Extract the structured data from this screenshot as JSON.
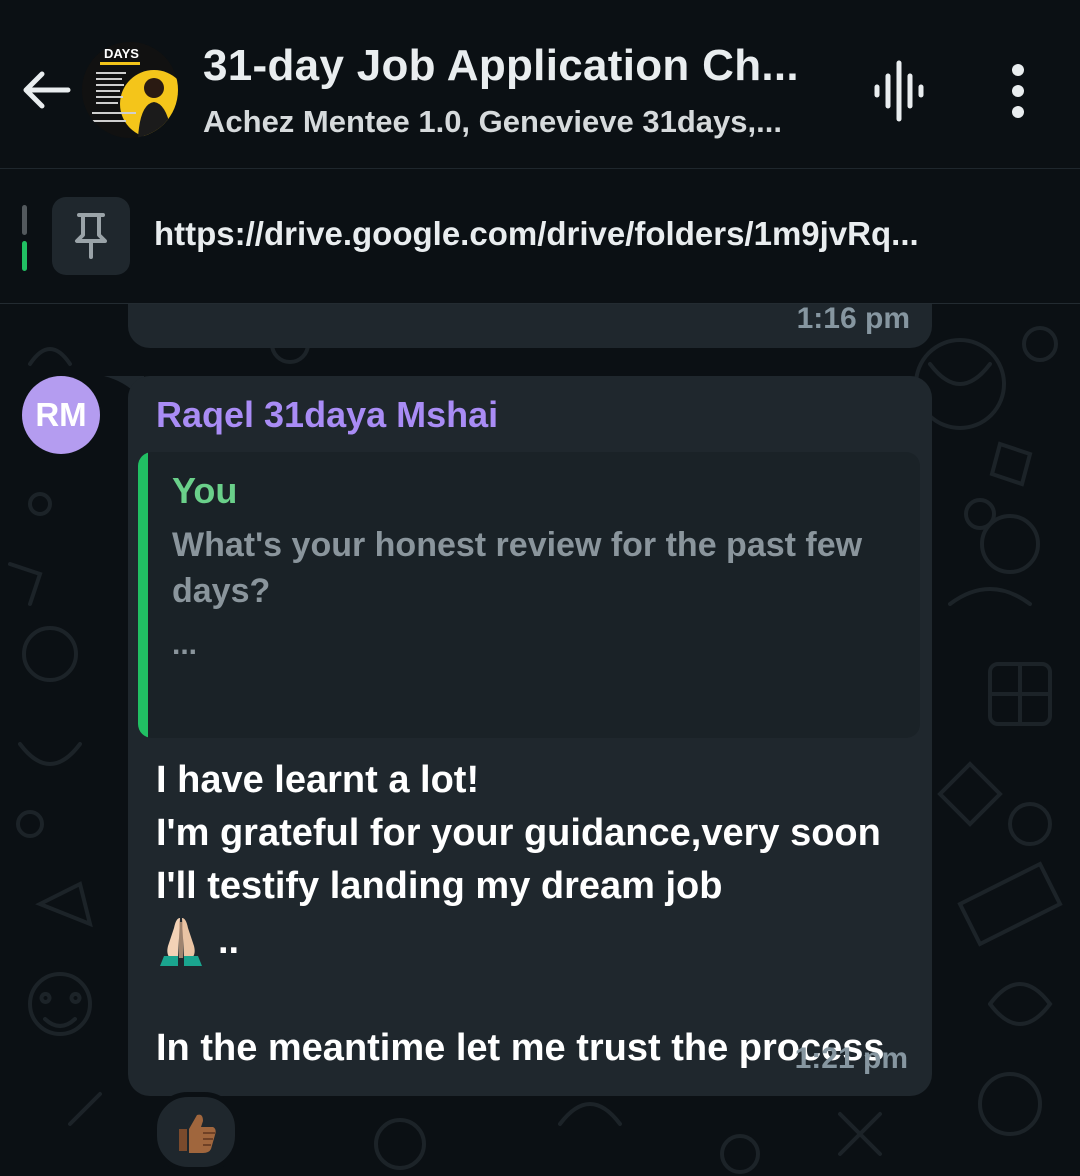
{
  "header": {
    "title": "31-day Job Application Ch...",
    "subtitle": "Achez Mentee 1.0, Genevieve 31days,...",
    "avatar_text": "DAYS"
  },
  "pinned": {
    "text": "https://drive.google.com/drive/folders/1m9jvRq..."
  },
  "previous_message": {
    "time": "1:16 pm"
  },
  "message": {
    "avatar_initials": "RM",
    "sender": "Raqel 31daya Mshai",
    "quote": {
      "author": "You",
      "text": "What's your honest review for the past few days?",
      "ellipsis": "..."
    },
    "lines": {
      "l1": "I have learnt a lot!",
      "l2": "I'm grateful for your guidance,very soon I'll testify landing my dream job",
      "l3": "..",
      "l4": "In the meantime let me trust the process"
    },
    "time": "1:21 pm",
    "reaction": "thumbs-up"
  },
  "colors": {
    "background": "#0b1014",
    "bubble": "#1f272d",
    "sender": "#a98cf5",
    "quote_author": "#6ad08a",
    "accent_green": "#21c063"
  }
}
